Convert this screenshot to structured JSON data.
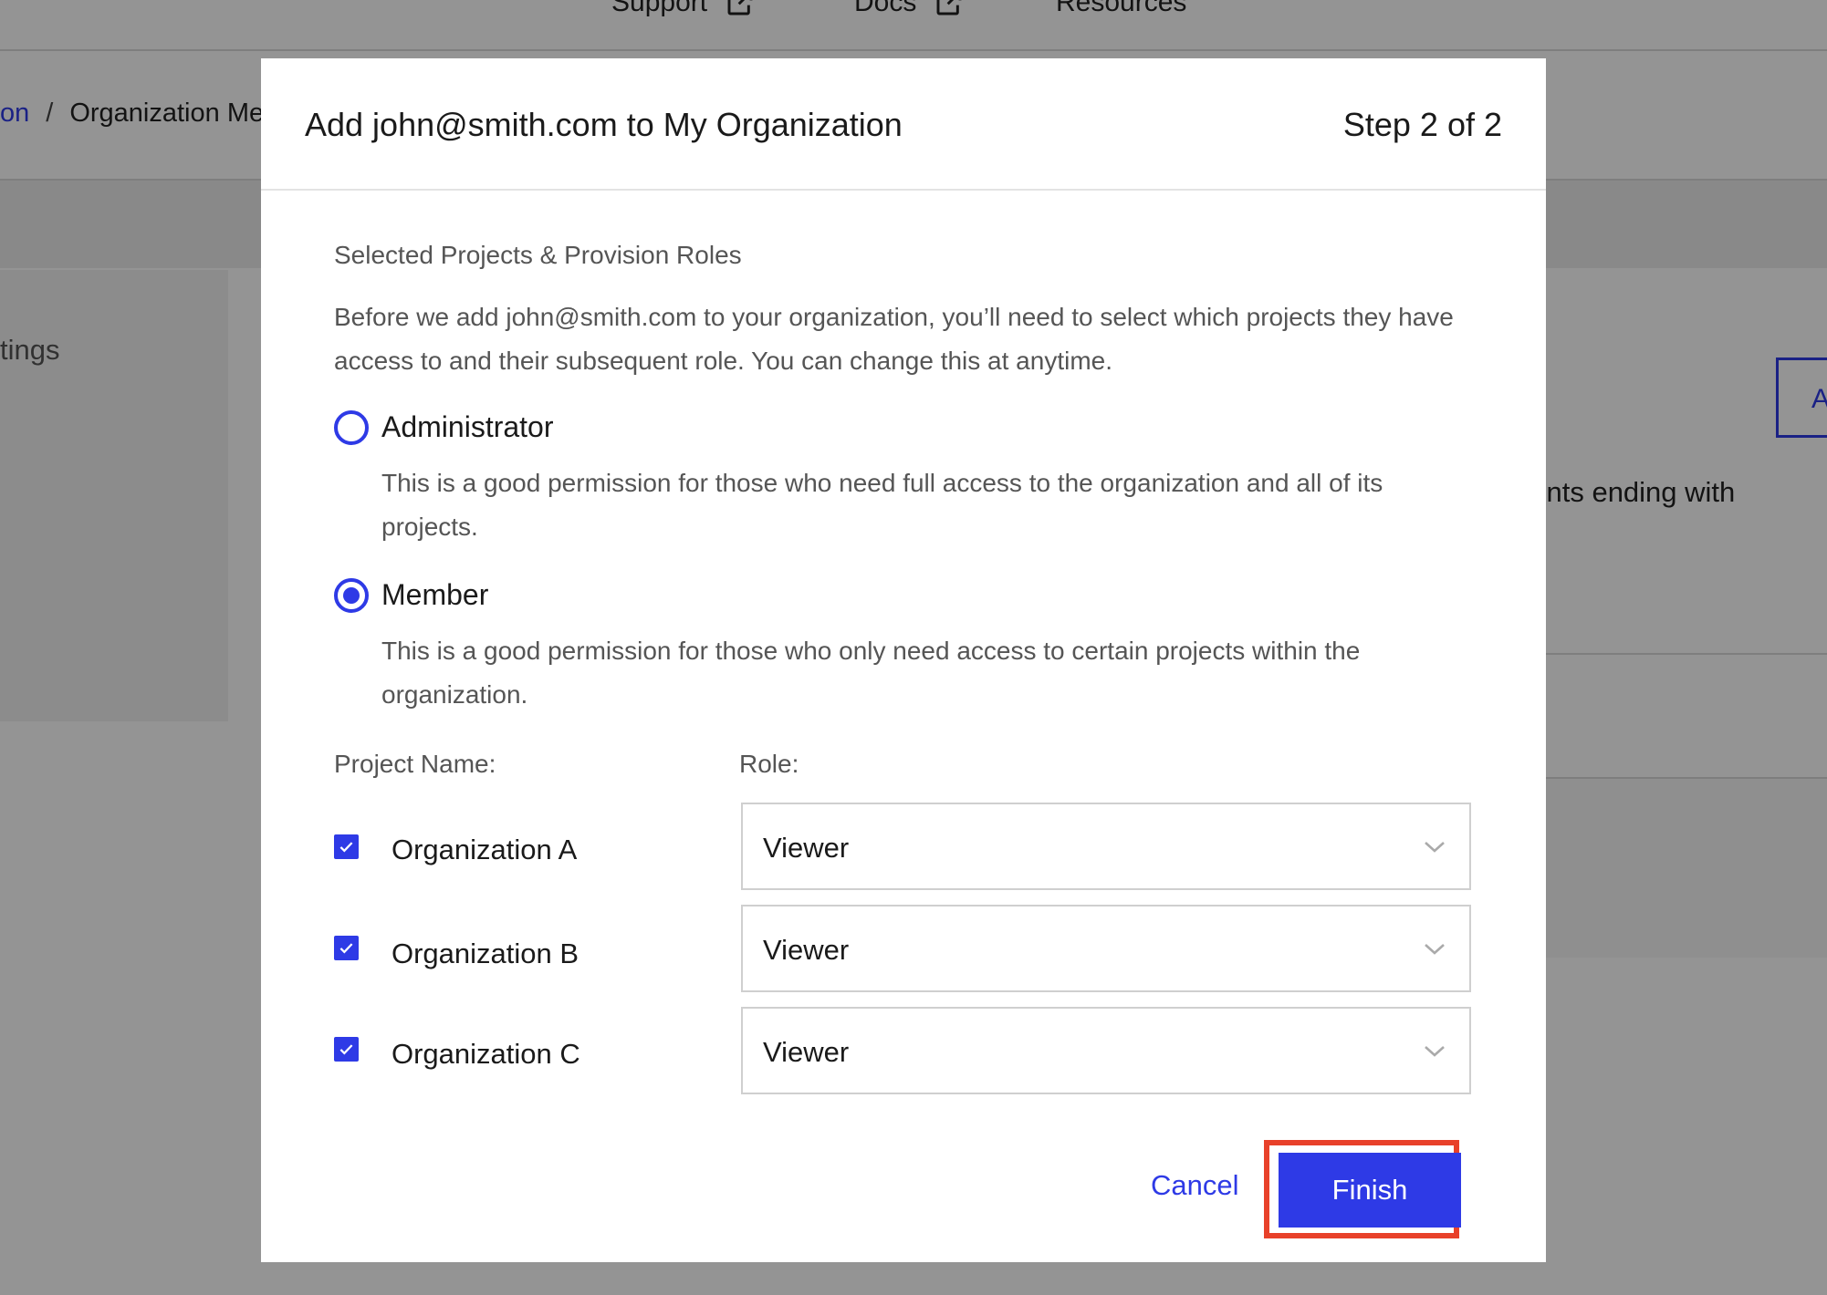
{
  "background": {
    "nav_items": [
      {
        "label": "Support",
        "icon": "external-link-icon"
      },
      {
        "label": "Docs",
        "icon": "external-link-icon"
      },
      {
        "label": "Resources"
      }
    ],
    "breadcrumb": {
      "link": "on",
      "separator": "/",
      "current": "Organization Me"
    },
    "side_text": "tings",
    "right_button_text": "A",
    "right_text": "ounts ending with"
  },
  "modal": {
    "title": "Add john@smith.com to My Organization",
    "step": "Step 2 of 2",
    "section_title": "Selected Projects & Provision Roles",
    "intro": "Before we add john@smith.com to your organization, you’ll need to select which projects they have access to and their subsequent role. You can change this at anytime.",
    "roles": [
      {
        "label": "Administrator",
        "description": "This is a good permission for those who need full access to the organization and all of its projects.",
        "selected": false
      },
      {
        "label": "Member",
        "description": "This is a good permission for those who only need access to certain projects within the organization.",
        "selected": true
      }
    ],
    "project_name_header": "Project Name:",
    "role_header": "Role:",
    "projects": [
      {
        "name": "Organization A",
        "checked": true,
        "role": "Viewer"
      },
      {
        "name": "Organization B",
        "checked": true,
        "role": "Viewer"
      },
      {
        "name": "Organization C",
        "checked": true,
        "role": "Viewer"
      }
    ],
    "cancel_label": "Cancel",
    "finish_label": "Finish"
  },
  "colors": {
    "accent": "#2e3ae6",
    "highlight": "#e8412a",
    "overlay": "rgba(0,0,0,0.42)"
  }
}
